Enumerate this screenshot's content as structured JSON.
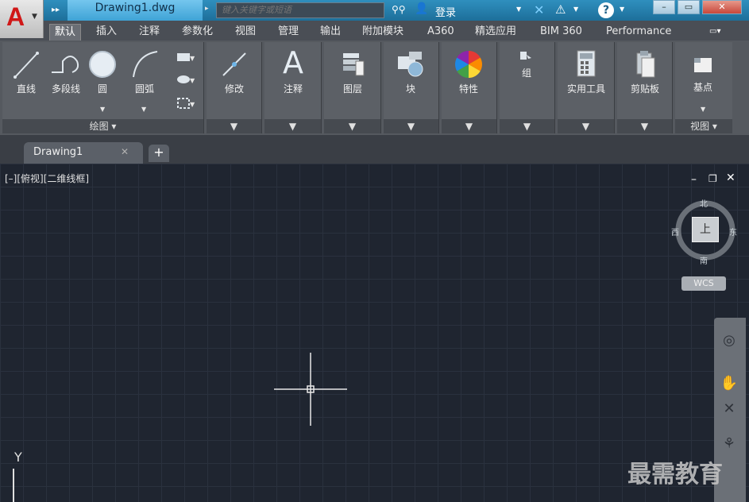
{
  "title_bar": {
    "app_logo": "A",
    "document_title": "Drawing1.dwg",
    "search_placeholder": "键入关键字或短语",
    "login_label": "登录",
    "help_glyph": "?",
    "win_min": "–",
    "win_max": "▭",
    "win_close": "✕"
  },
  "ribbon_tabs": [
    {
      "label": "默认",
      "active": true
    },
    {
      "label": "插入"
    },
    {
      "label": "注释"
    },
    {
      "label": "参数化"
    },
    {
      "label": "视图"
    },
    {
      "label": "管理"
    },
    {
      "label": "输出"
    },
    {
      "label": "附加模块"
    },
    {
      "label": "A360"
    },
    {
      "label": "精选应用"
    },
    {
      "label": "BIM 360"
    },
    {
      "label": "Performance"
    }
  ],
  "panels": {
    "draw": {
      "footer": "绘图 ▾",
      "line": "直线",
      "polyline": "多段线",
      "circle": "圆",
      "arc": "圆弧"
    },
    "modify": {
      "label": "修改"
    },
    "annotation": {
      "label": "注释",
      "glyph": "A"
    },
    "layers": {
      "label": "图层"
    },
    "block": {
      "label": "块"
    },
    "properties": {
      "label": "特性"
    },
    "groups": {
      "label": "组"
    },
    "utilities": {
      "label": "实用工具"
    },
    "clipboard": {
      "label": "剪贴板"
    },
    "base": {
      "label": "基点",
      "footer": "视图 ▾"
    }
  },
  "file_tabs": {
    "active": "Drawing1",
    "close": "✕",
    "new": "+"
  },
  "viewport": {
    "label": "[–][俯视][二维线框]",
    "min": "–",
    "restore": "❐",
    "close": "✕"
  },
  "viewcube": {
    "north": "北",
    "south": "南",
    "east": "东",
    "west": "西",
    "top_face": "上",
    "wcs": "WCS"
  },
  "ucs": {
    "y": "Y"
  },
  "watermark": "最需教育",
  "colors": {
    "accent": "#2f8fbe",
    "canvas": "#1f2530",
    "logo_red": "#d01818"
  }
}
